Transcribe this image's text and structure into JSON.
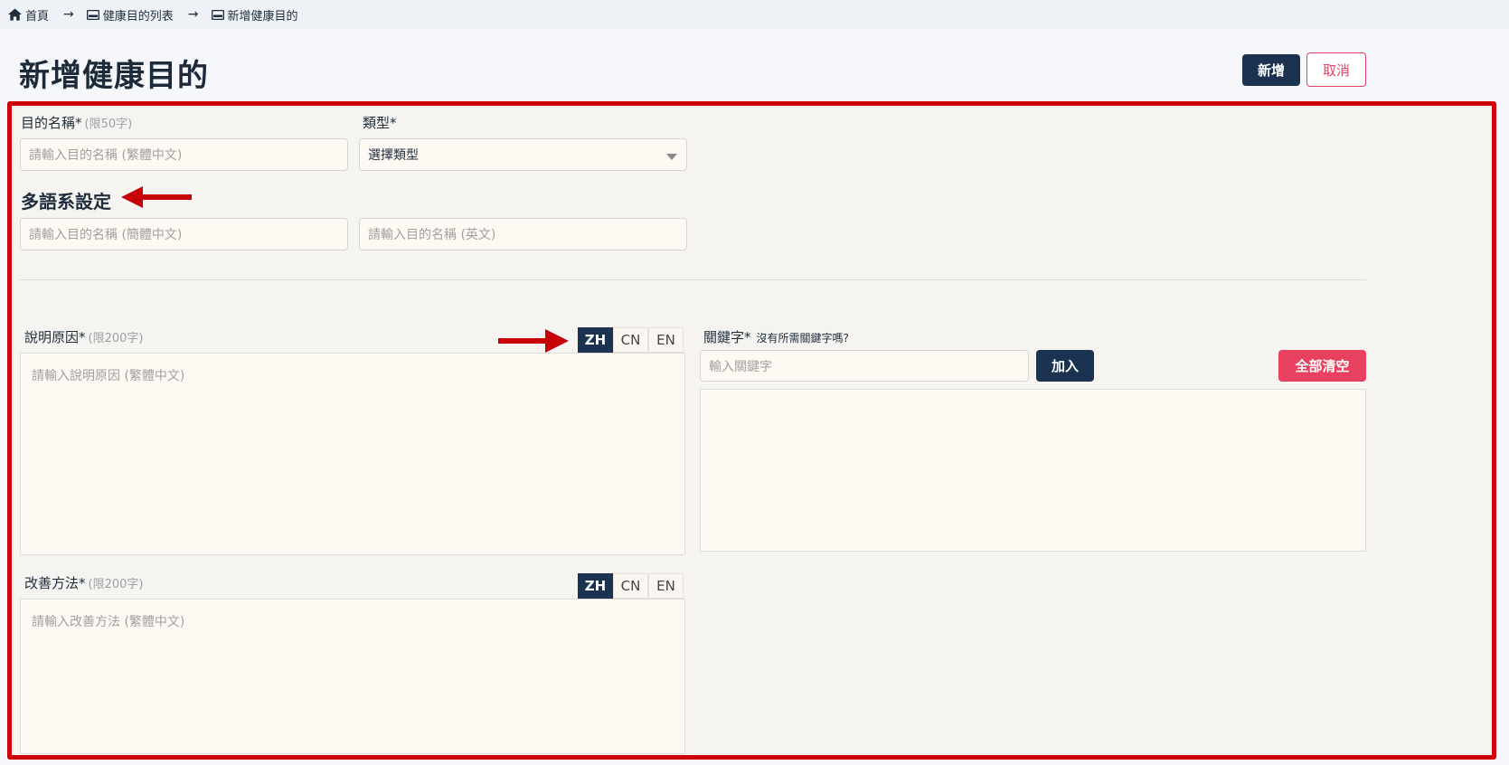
{
  "breadcrumb": {
    "home": "首頁",
    "list": "健康目的列表",
    "current": "新增健康目的",
    "separator": "→"
  },
  "page_title": "新增健康目的",
  "actions": {
    "add": "新增",
    "cancel": "取消"
  },
  "form": {
    "name": {
      "label": "目的名稱*",
      "hint": "(限50字)",
      "placeholder": "請輸入目的名稱 (繁體中文)"
    },
    "type": {
      "label": "類型*",
      "selected": "選擇類型"
    },
    "multilang": {
      "title": "多語系設定",
      "cn_placeholder": "請輸入目的名稱 (簡體中文)",
      "en_placeholder": "請輸入目的名稱 (英文)"
    },
    "reason": {
      "label": "說明原因*",
      "hint": "(限200字)",
      "placeholder": "請輸入說明原因 (繁體中文)"
    },
    "method": {
      "label": "改善方法*",
      "hint": "(限200字)",
      "placeholder": "請輸入改善方法 (繁體中文)"
    },
    "lang_tabs": [
      "ZH",
      "CN",
      "EN"
    ],
    "keywords": {
      "label": "關鍵字*",
      "hint": "沒有所需關鍵字嗎?",
      "placeholder": "輸入關鍵字",
      "add": "加入",
      "clear_all": "全部清空"
    }
  },
  "colors": {
    "primary": "#1b3350",
    "danger": "#e8405f",
    "highlight": "#d0000a"
  }
}
